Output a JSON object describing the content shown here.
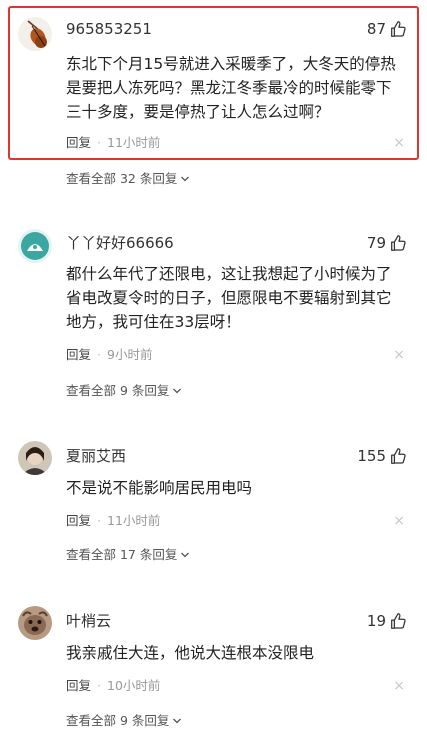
{
  "comments": [
    {
      "username": "965853251",
      "likes": "87",
      "text_lines": [
        "东北下个月15号就进入采暖季了，大冬天的停热",
        "是要把人冻死吗？黑龙江冬季最冷的时候能零下",
        "三十多度，要是停热了让人怎么过啊？"
      ],
      "reply_label": "回复",
      "time": "11小时前",
      "view_all": "查看全部 32 条回复",
      "avatar_icon": "violin-icon"
    },
    {
      "username": "丫丫好好66666",
      "likes": "79",
      "text_lines": [
        "都什么年代了还限电，这让我想起了小时候为了",
        "省电改夏令时的日子，但愿限电不要辐射到其它",
        "地方，我可住在33层呀！"
      ],
      "reply_label": "回复",
      "time": "9小时前",
      "view_all": "查看全部 9 条回复",
      "avatar_icon": "teal-avatar-icon"
    },
    {
      "username": "夏丽艾西",
      "likes": "155",
      "text_lines": [
        "不是说不能影响居民用电吗"
      ],
      "reply_label": "回复",
      "time": "11小时前",
      "view_all": "查看全部 17 条回复",
      "avatar_icon": "photo-avatar-icon"
    },
    {
      "username": "叶梢云",
      "likes": "19",
      "text_lines": [
        "我亲戚住大连，他说大连根本没限电"
      ],
      "reply_label": "回复",
      "time": "10小时前",
      "view_all": "查看全部 9 条回复",
      "avatar_icon": "dog-avatar-icon"
    }
  ],
  "close_symbol": "×",
  "separator": "·",
  "colors": {
    "highlight": "#e0342c",
    "meta": "#999999",
    "teal": "#3aa8a0"
  }
}
